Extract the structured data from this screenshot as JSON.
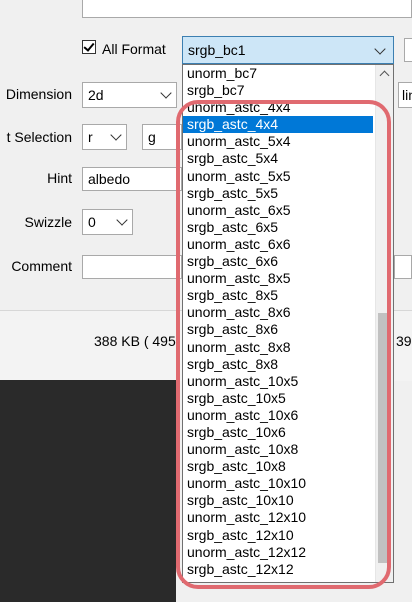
{
  "form": {
    "all_format_label": "All Format",
    "format_selected": "srgb_bc1",
    "dimension_label": "Dimension",
    "dimension_value": "2d",
    "channel_label": "t Selection",
    "channel_r": "r",
    "channel_g": "g",
    "hint_label": "Hint",
    "hint_value": "albedo",
    "swizzle_label": "Swizzle",
    "swizzle_value": "0",
    "comment_label": "Comment",
    "right_frag": "lin"
  },
  "footer": {
    "size_text": "388 KB ( 495",
    "size_right": "39"
  },
  "dropdown": {
    "selected_index": 3,
    "options": [
      "unorm_bc7",
      "srgb_bc7",
      "unorm_astc_4x4",
      "srgb_astc_4x4",
      "unorm_astc_5x4",
      "srgb_astc_5x4",
      "unorm_astc_5x5",
      "srgb_astc_5x5",
      "unorm_astc_6x5",
      "srgb_astc_6x5",
      "unorm_astc_6x6",
      "srgb_astc_6x6",
      "unorm_astc_8x5",
      "srgb_astc_8x5",
      "unorm_astc_8x6",
      "srgb_astc_8x6",
      "unorm_astc_8x8",
      "srgb_astc_8x8",
      "unorm_astc_10x5",
      "srgb_astc_10x5",
      "unorm_astc_10x6",
      "srgb_astc_10x6",
      "unorm_astc_10x8",
      "srgb_astc_10x8",
      "unorm_astc_10x10",
      "srgb_astc_10x10",
      "unorm_astc_12x10",
      "srgb_astc_12x10",
      "unorm_astc_12x12",
      "srgb_astc_12x12"
    ]
  },
  "colors": {
    "selection": "#0078d7",
    "highlight_ring": "#e06a70",
    "combo_focus": "#cde6f7"
  }
}
